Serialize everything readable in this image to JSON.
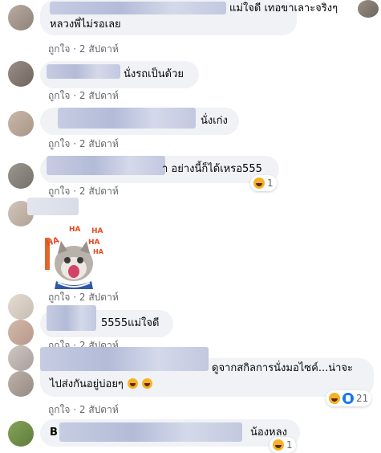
{
  "comments": [
    {
      "text": "แม่ใจดี เทอขาเลาะจริงๆ",
      "text2": "หลวงพี่ไม่รอเลย",
      "like": "ถูกใจ",
      "time": "2 สัปดาห์"
    },
    {
      "text": "นั่งรถเป็นด้วย",
      "like": "ถูกใจ",
      "time": "2 สัปดาห์"
    },
    {
      "text": "นั่งเก่ง",
      "like": "ถูกใจ",
      "time": "2 สัปดาห์"
    },
    {
      "text": "า อย่างนี้ก็ได้เหรอ555",
      "like": "ถูกใจ",
      "time": "2 สัปดาห์",
      "reaction_count": "1"
    },
    {
      "sticker": "haha-cat-sticker",
      "sticker_words": [
        "HA",
        "HA",
        "HA",
        "HA",
        "HA"
      ],
      "like": "ถูกใจ",
      "time": "2 สัปดาห์"
    },
    {
      "text": "5555แม่ใจดี",
      "like": "ถูกใจ",
      "time": "2 สัปดาห์"
    },
    {
      "text": "ดูจากสกิลการนั่งมอไซค์...น่าจะ",
      "text2": "ไปส่งกันอยู่บ่อยๆ",
      "like": "ถูกใจ",
      "time": "2 สัปดาห์",
      "reaction_count": "21"
    },
    {
      "text_prefix": "B",
      "text": "น้องหลง",
      "like": "ถูกใจ",
      "time": "2 สัปดาห์",
      "reaction_count": "1"
    }
  ],
  "icons": {
    "haha": "haha-reaction-icon",
    "like": "like-reaction-icon"
  },
  "colors": {
    "bubble": "#f0f2f5",
    "meta": "#65676b",
    "haha": "#f7b125",
    "like": "#1877f2"
  }
}
